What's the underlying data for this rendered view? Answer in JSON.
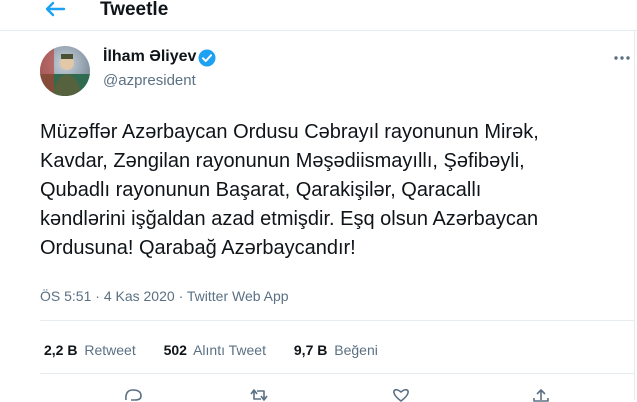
{
  "header": {
    "title": "Tweetle",
    "back_icon": "arrow-left-icon"
  },
  "colors": {
    "accent": "#1da1f2",
    "text": "#0f1419",
    "secondary": "#5b7083",
    "divider": "#e6ecf0"
  },
  "tweet": {
    "author": {
      "name": "İlham Əliyev",
      "handle": "@azpresident",
      "verified": true
    },
    "text_lines": [
      "Müzəffər Azərbaycan Ordusu Cəbrayıl rayonunun Mirək,",
      "Kavdar, Zəngilan rayonunun Məşədiismayıllı, Şəfibəyli,",
      "Qubadlı rayonunun Başarat, Qarakişilər, Qaracallı",
      "kəndlərini işğaldan azad etmişdir. Eşq olsun Azərbaycan",
      "Ordusuna! Qarabağ Azərbaycandır!"
    ],
    "time": "ÖS 5:51",
    "separator": "·",
    "date": "4 Kas 2020",
    "source": "Twitter Web App",
    "stats": [
      {
        "value": "2,2 B",
        "label": "Retweet"
      },
      {
        "value": "502",
        "label": "Alıntı Tweet"
      },
      {
        "value": "9,7 B",
        "label": "Beğeni"
      }
    ],
    "action_icons": [
      "reply-icon",
      "retweet-icon",
      "like-icon",
      "share-icon"
    ]
  }
}
